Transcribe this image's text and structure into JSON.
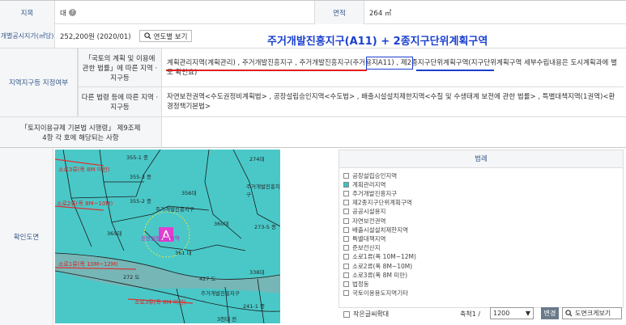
{
  "row1": {
    "land_category_label": "지목",
    "land_category_value": "대",
    "area_label": "면적",
    "area_value": "264 ㎡"
  },
  "row2": {
    "price_label": "개별공시지가(㎡당)",
    "price_value": "252,200원 (2020/01)",
    "price_button": "연도별 보기"
  },
  "overlay_text": "주거개발진흥지구(A11) + 2종지구단위계획구역",
  "zoning": {
    "section_label": "지역지구등 지정여부",
    "national_law_label": "「국토의 계획 및 이용에 관한 법률」에 따른 지역 · 지구등",
    "national_law_value": "계획관리지역(계획관리) , 주거개발진흥지구 , 주거개발진흥지구(주거용지A11) , 제2종지구단위계획구역(지구단위계획구역 세부수립내용은 도시계획과에 별도 확인요)",
    "other_law_label": "다른 법령 등에 따른 지역 · 지구등",
    "other_law_value": "자연보전권역<수도권정비계획법> , 공장설립승인지역<수도법> , 배출시설설치제한지역<수질 및 수생태계 보전에 관한 법률> , 특별대책지역(1권역)<환경정책기본법>",
    "enforcement_label": "「토지이용규제 기본법 시행령」 제9조제4항 각 호에 해당되는 사항"
  },
  "map_section": {
    "label": "확인도면",
    "legend_title": "범례",
    "legend": [
      {
        "label": "공장설립승인지역",
        "color": "#ffffff"
      },
      {
        "label": "계획관리지역",
        "color": "#40c0c0"
      },
      {
        "label": "주거개발진흥지구",
        "color": "#ffffff"
      },
      {
        "label": "제2종지구단위계획구역",
        "color": "#ffffff"
      },
      {
        "label": "공공시설용지",
        "color": "#ffffff"
      },
      {
        "label": "자연보전권역",
        "color": "#ffffff"
      },
      {
        "label": "배출시설설치제한지역",
        "color": "#ffffff"
      },
      {
        "label": "특별대책지역",
        "color": "#ffffff"
      },
      {
        "label": "준보전산지",
        "color": "#ffffff"
      },
      {
        "label": "소로1류(폭 10M~12M)",
        "color": "#ffffff"
      },
      {
        "label": "소로2류(폭 8M~10M)",
        "color": "#ffffff"
      },
      {
        "label": "소로3류(폭 8M 미만)",
        "color": "#ffffff"
      },
      {
        "label": "법정동",
        "color": "#ffffff"
      },
      {
        "label": "국토이용용도지역기타",
        "color": "#ffffff"
      }
    ],
    "small_text_label": "작은글씨확대",
    "scale_label": "축척1 /",
    "scale_value": "1200",
    "change_button": "변경",
    "enlarge_button": "도면크게보기"
  },
  "map_labels": {
    "parcels": [
      "355-1 종",
      "355-3 종",
      "355-2 종",
      "274대",
      "356대",
      "360대",
      "365대",
      "361 대",
      "272 도",
      "427 도",
      "241-1 종",
      "273-5 종",
      "주거개발진흥지구",
      "주거개발진흥지구",
      "주거개발진흥지구",
      "338대",
      "3천대 전"
    ],
    "roads": [
      "소로3류(폭 8M 미만)",
      "소로2류(폭 8M~10M)",
      "소로1류(폭 10M~12M)",
      "소로3류(폭 8M 미만)"
    ],
    "site": "공장설립승인지역"
  }
}
